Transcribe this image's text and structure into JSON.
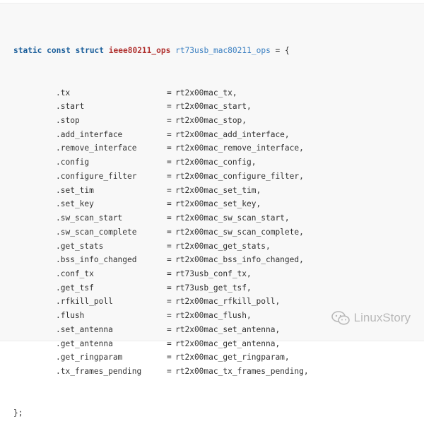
{
  "code": {
    "header": {
      "keyword_static": "static",
      "keyword_const": "const",
      "keyword_struct": "struct",
      "type_name": "ieee80211_ops",
      "var_name": "rt73usb_mac80211_ops",
      "tail": " = {"
    },
    "assignments": [
      {
        "field": ".tx",
        "value": "rt2x00mac_tx,"
      },
      {
        "field": ".start",
        "value": "rt2x00mac_start,"
      },
      {
        "field": ".stop",
        "value": "rt2x00mac_stop,"
      },
      {
        "field": ".add_interface",
        "value": "rt2x00mac_add_interface,"
      },
      {
        "field": ".remove_interface",
        "value": "rt2x00mac_remove_interface,"
      },
      {
        "field": ".config",
        "value": "rt2x00mac_config,"
      },
      {
        "field": ".configure_filter",
        "value": "rt2x00mac_configure_filter,"
      },
      {
        "field": ".set_tim",
        "value": "rt2x00mac_set_tim,"
      },
      {
        "field": ".set_key",
        "value": "rt2x00mac_set_key,"
      },
      {
        "field": ".sw_scan_start",
        "value": "rt2x00mac_sw_scan_start,"
      },
      {
        "field": ".sw_scan_complete",
        "value": "rt2x00mac_sw_scan_complete,"
      },
      {
        "field": ".get_stats",
        "value": "rt2x00mac_get_stats,"
      },
      {
        "field": ".bss_info_changed",
        "value": "rt2x00mac_bss_info_changed,"
      },
      {
        "field": ".conf_tx",
        "value": "rt73usb_conf_tx,"
      },
      {
        "field": ".get_tsf",
        "value": "rt73usb_get_tsf,"
      },
      {
        "field": ".rfkill_poll",
        "value": "rt2x00mac_rfkill_poll,"
      },
      {
        "field": ".flush",
        "value": "rt2x00mac_flush,"
      },
      {
        "field": ".set_antenna",
        "value": "rt2x00mac_set_antenna,"
      },
      {
        "field": ".get_antenna",
        "value": "rt2x00mac_get_antenna,"
      },
      {
        "field": ".get_ringparam",
        "value": "rt2x00mac_get_ringparam,"
      },
      {
        "field": ".tx_frames_pending",
        "value": "rt2x00mac_tx_frames_pending,"
      }
    ],
    "operator": "=",
    "footer": "};"
  },
  "watermark": {
    "text": "LinuxStory",
    "icon": "wechat-icon",
    "color": "#b9b9b9"
  },
  "colors": {
    "background": "#f8f8f8",
    "keyword": "#1c5f9b",
    "type": "#b0312f",
    "identifier": "#3a7fc1",
    "text": "#333333"
  }
}
